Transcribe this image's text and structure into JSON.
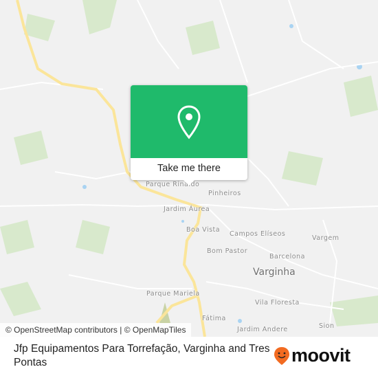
{
  "map": {
    "labels": {
      "parque_rinaldo": "Parque Rinaldo",
      "pinheiros": "Pinheiros",
      "jardim_aurea": "Jardim Áurea",
      "boa_vista": "Boa Vista",
      "campos_eliseos": "Campos Elíseos",
      "vargem": "Vargem",
      "bom_pastor": "Bom Pastor",
      "barcelona": "Barcelona",
      "varginha": "Varginha",
      "parque_mariela": "Parque Mariela",
      "vila_floresta": "Vila Floresta",
      "fatima": "Fátima",
      "jardim_andere": "Jardim Andere",
      "sion": "Sion"
    },
    "colors": {
      "background": "#f1f1f1",
      "road": "#ffffff",
      "highway": "#fbe59a",
      "park": "#d5e8c8",
      "water": "#a9d3f2"
    },
    "attribution": "© OpenStreetMap contributors | © OpenMapTiles"
  },
  "popup": {
    "icon": "location-pin-icon",
    "button_label": "Take me there",
    "color": "#1fba6b"
  },
  "footer": {
    "title": "Jfp Equipamentos Para Torrefação, Varginha and Tres Pontas",
    "logo_text": "moovit",
    "logo_color": "#f26b21"
  }
}
